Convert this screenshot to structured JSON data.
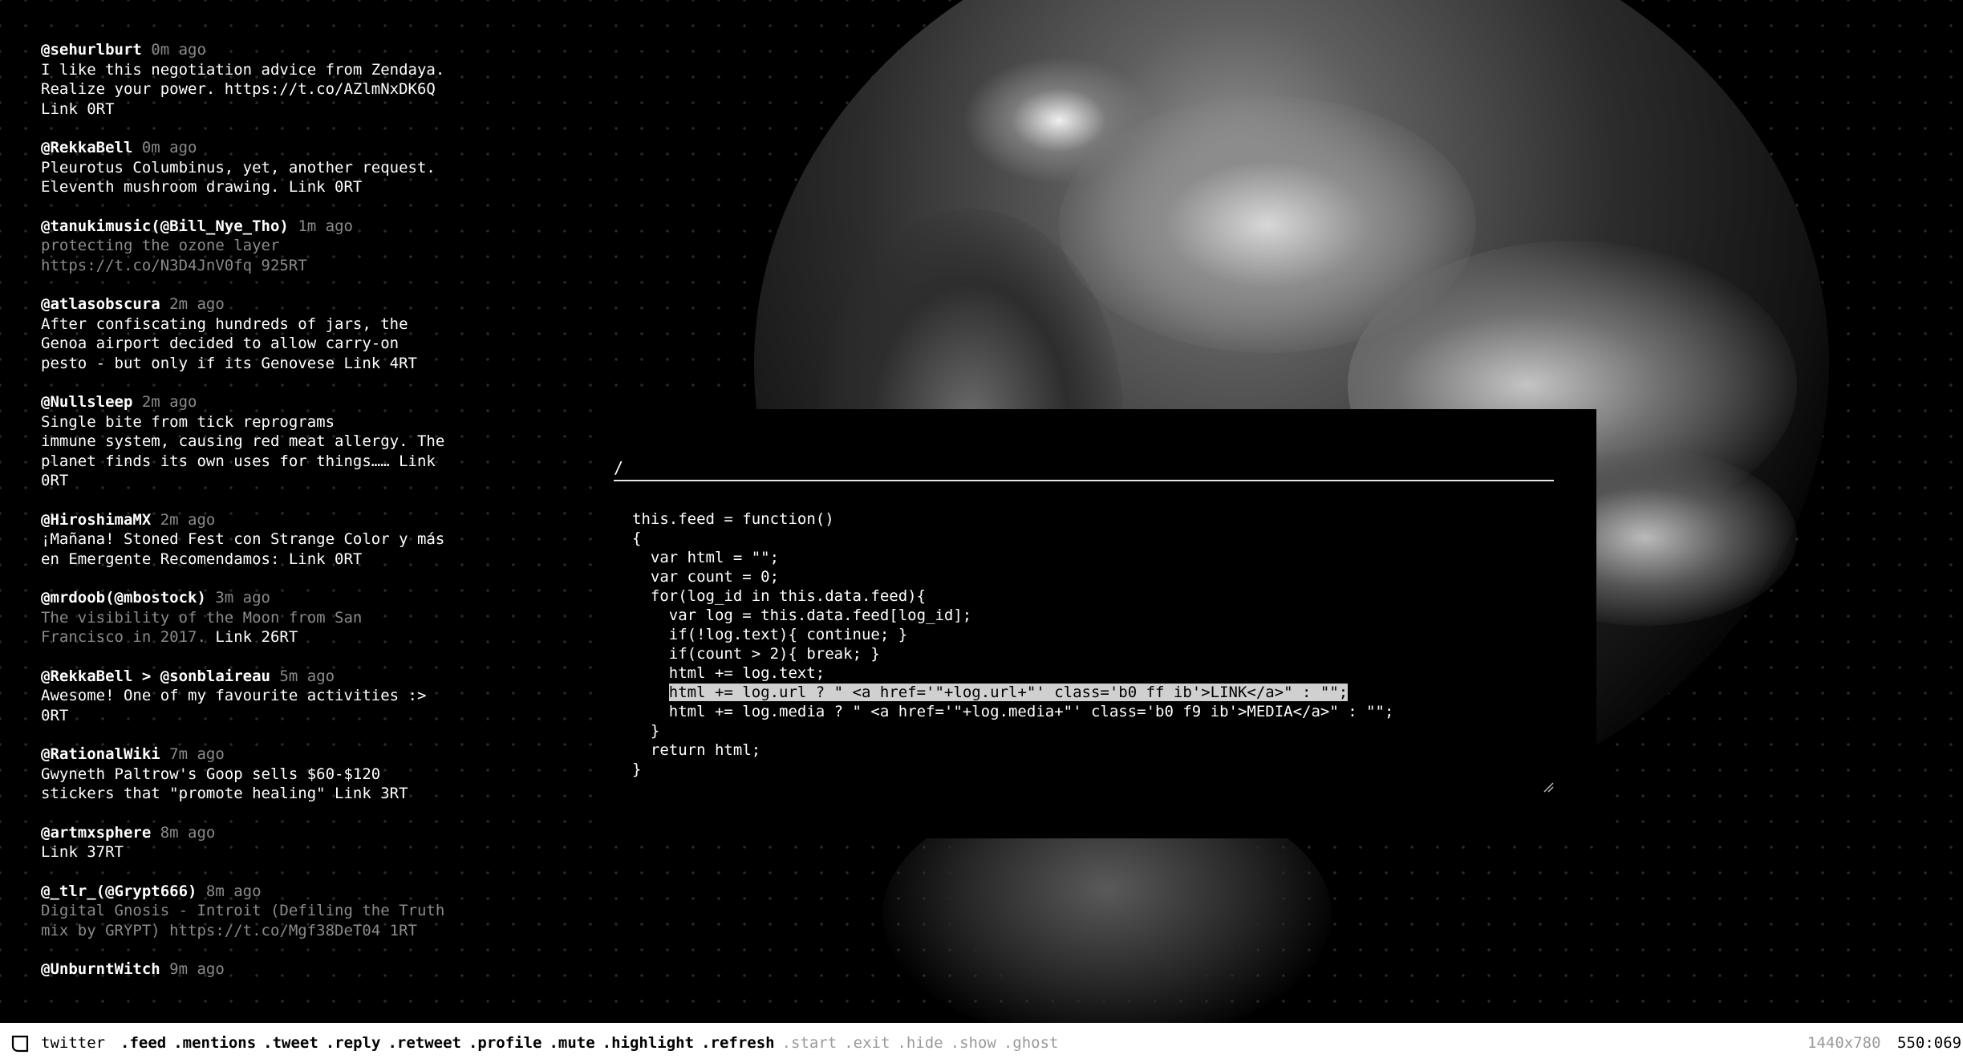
{
  "feed": {
    "tweets": [
      {
        "user": "@sehurlburt",
        "time": "0m ago",
        "text": "I like this negotiation advice from Zendaya.\nRealize your power. https://t.co/AZlmNxDK6Q\nLink 0RT"
      },
      {
        "user": "@RekkaBell",
        "time": "0m ago",
        "text": "Pleurotus Columbinus, yet, another request.\nEleventh mushroom drawing. Link 0RT"
      },
      {
        "user": "@tanukimusic(@Bill_Nye_Tho)",
        "time": "1m ago",
        "text": "protecting the ozone layer\nhttps://t.co/N3D4JnV0fq 925RT"
      },
      {
        "user": "@atlasobscura",
        "time": "2m ago",
        "text": "After confiscating hundreds of jars, the\nGenoa airport decided to allow carry-on\npesto - but only if its Genovese Link 4RT"
      },
      {
        "user": "@Nullsleep",
        "time": "2m ago",
        "text": "Single bite from tick reprograms\nimmune system, causing red meat allergy. The\nplanet finds its own uses for things…… Link\n0RT"
      },
      {
        "user": "@HiroshimaMX",
        "time": "2m ago",
        "text": "¡Mañana! Stoned Fest con Strange Color y más\nen Emergente Recomendamos: Link 0RT"
      },
      {
        "user": "@mrdoob(@mbostock)",
        "time": "3m ago",
        "text": "The visibility of the Moon from San\nFrancisco in 2017.",
        "link": " Link 26RT"
      },
      {
        "user": "@RekkaBell > @sonblaireau",
        "time": "5m ago",
        "text": "Awesome! One of my favourite activities :>\n0RT"
      },
      {
        "user": "@RationalWiki",
        "time": "7m ago",
        "text": "Gwyneth Paltrow's Goop sells $60-$120\nstickers that \"promote healing\" Link 3RT"
      },
      {
        "user": "@artmxsphere",
        "time": "8m ago",
        "text": "Link 37RT"
      },
      {
        "user": "@_tlr_(@Grypt666)",
        "time": "8m ago",
        "text": "Digital Gnosis - Introit (Defiling the Truth\nmix by GRYPT) https://t.co/Mgf38DeT04 1RT"
      },
      {
        "user": "@UnburntWitch",
        "time": "9m ago",
        "text": ""
      }
    ]
  },
  "console": {
    "command": "/",
    "code_before": "this.feed = function()\n{\n  var html = \"\";\n  var count = 0;\n  for(log_id in this.data.feed){\n    var log = this.data.feed[log_id];\n    if(!log.text){ continue; }\n    if(count > 2){ break; }\n    html += log.text;\n    ",
    "code_selected": "html += log.url ? \" <a href='\"+log.url+\"' class='b0 ff ib'>LINK</a>\" : \"\";",
    "code_after": "\n    html += log.media ? \" <a href='\"+log.media+\"' class='b0 f9 ib'>MEDIA</a>\" : \"\";\n  }\n  return html;\n}"
  },
  "statusbar": {
    "app": "twitter",
    "commands": [
      ".feed",
      ".mentions",
      ".tweet",
      ".reply",
      ".retweet",
      ".profile",
      ".mute",
      ".highlight",
      ".refresh"
    ],
    "muted_commands": [
      ".start",
      ".exit",
      ".hide",
      ".show",
      ".ghost"
    ],
    "resolution": "1440x780",
    "cursor": "550:069"
  }
}
